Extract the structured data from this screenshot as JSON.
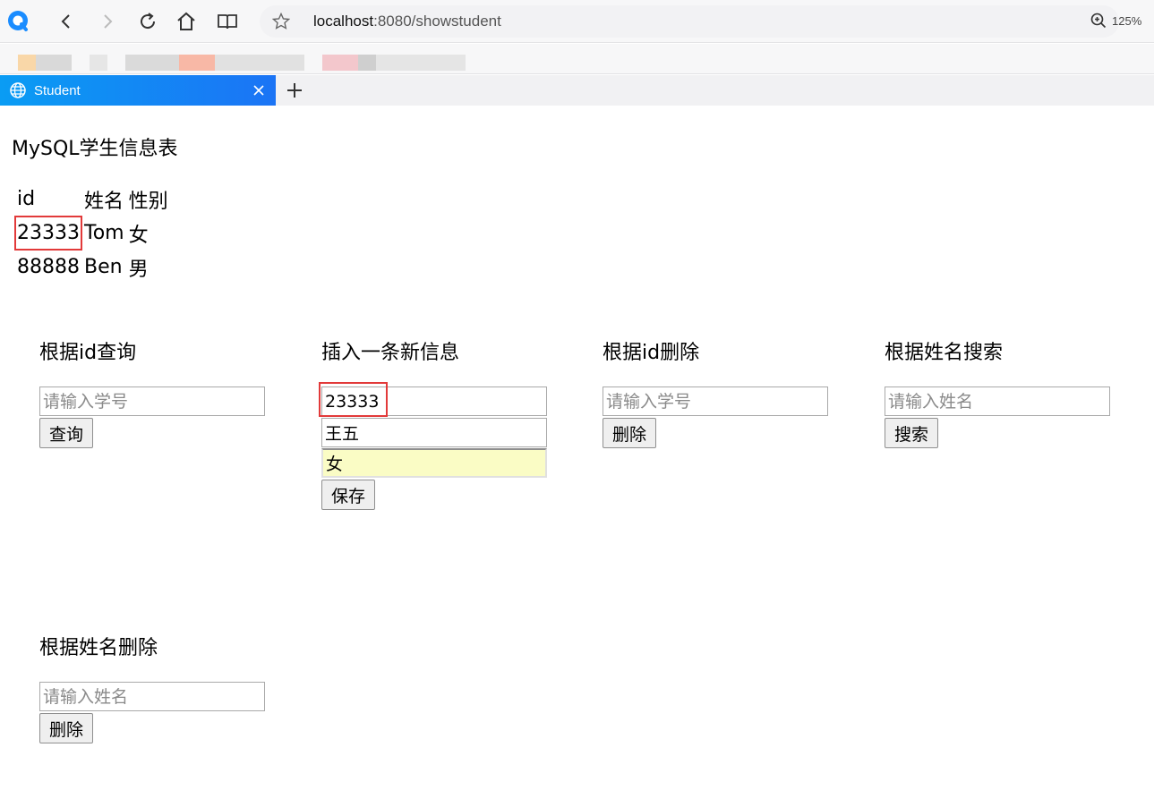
{
  "browser": {
    "url_host": "localhost",
    "url_path": ":8080/showstudent",
    "zoom": "125%",
    "tab_title": "Student"
  },
  "page": {
    "title": "MySQL学生信息表",
    "table": {
      "headers": [
        "id",
        "姓名",
        "性别"
      ],
      "rows": [
        [
          "23333",
          "Tom",
          "女"
        ],
        [
          "88888",
          "Ben",
          "男"
        ]
      ]
    },
    "query_by_id": {
      "title": "根据id查询",
      "placeholder": "请输入学号",
      "button": "查询"
    },
    "insert": {
      "title": "插入一条新信息",
      "id_value": "23333",
      "name_value": "王五",
      "gender_value": "女",
      "button": "保存"
    },
    "delete_by_id": {
      "title": "根据id删除",
      "placeholder": "请输入学号",
      "button": "删除"
    },
    "search_by_name": {
      "title": "根据姓名搜索",
      "placeholder": "请输入姓名",
      "button": "搜索"
    },
    "delete_by_name": {
      "title": "根据姓名删除",
      "placeholder": "请输入姓名",
      "button": "删除"
    }
  }
}
